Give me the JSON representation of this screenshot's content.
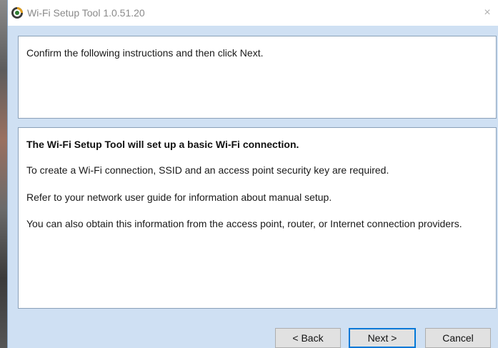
{
  "window": {
    "title": "Wi-Fi Setup Tool 1.0.51.20",
    "close_glyph": "×",
    "app_icon": "wifi-setup-app-icon",
    "accent": "#0078d7",
    "background": "#cfe0f3"
  },
  "instruction_panel": {
    "text": "Confirm the following instructions and then click Next."
  },
  "info_panel": {
    "heading": "The Wi-Fi Setup Tool will set up a basic Wi-Fi connection.",
    "lines": [
      "To create a Wi-Fi connection, SSID and an access point security key are required.",
      "Refer to your network user guide for information about manual setup.",
      "You can also obtain this information from the access point, router, or Internet connection providers."
    ]
  },
  "buttons": {
    "back": "< Back",
    "next": "Next >",
    "cancel": "Cancel"
  }
}
